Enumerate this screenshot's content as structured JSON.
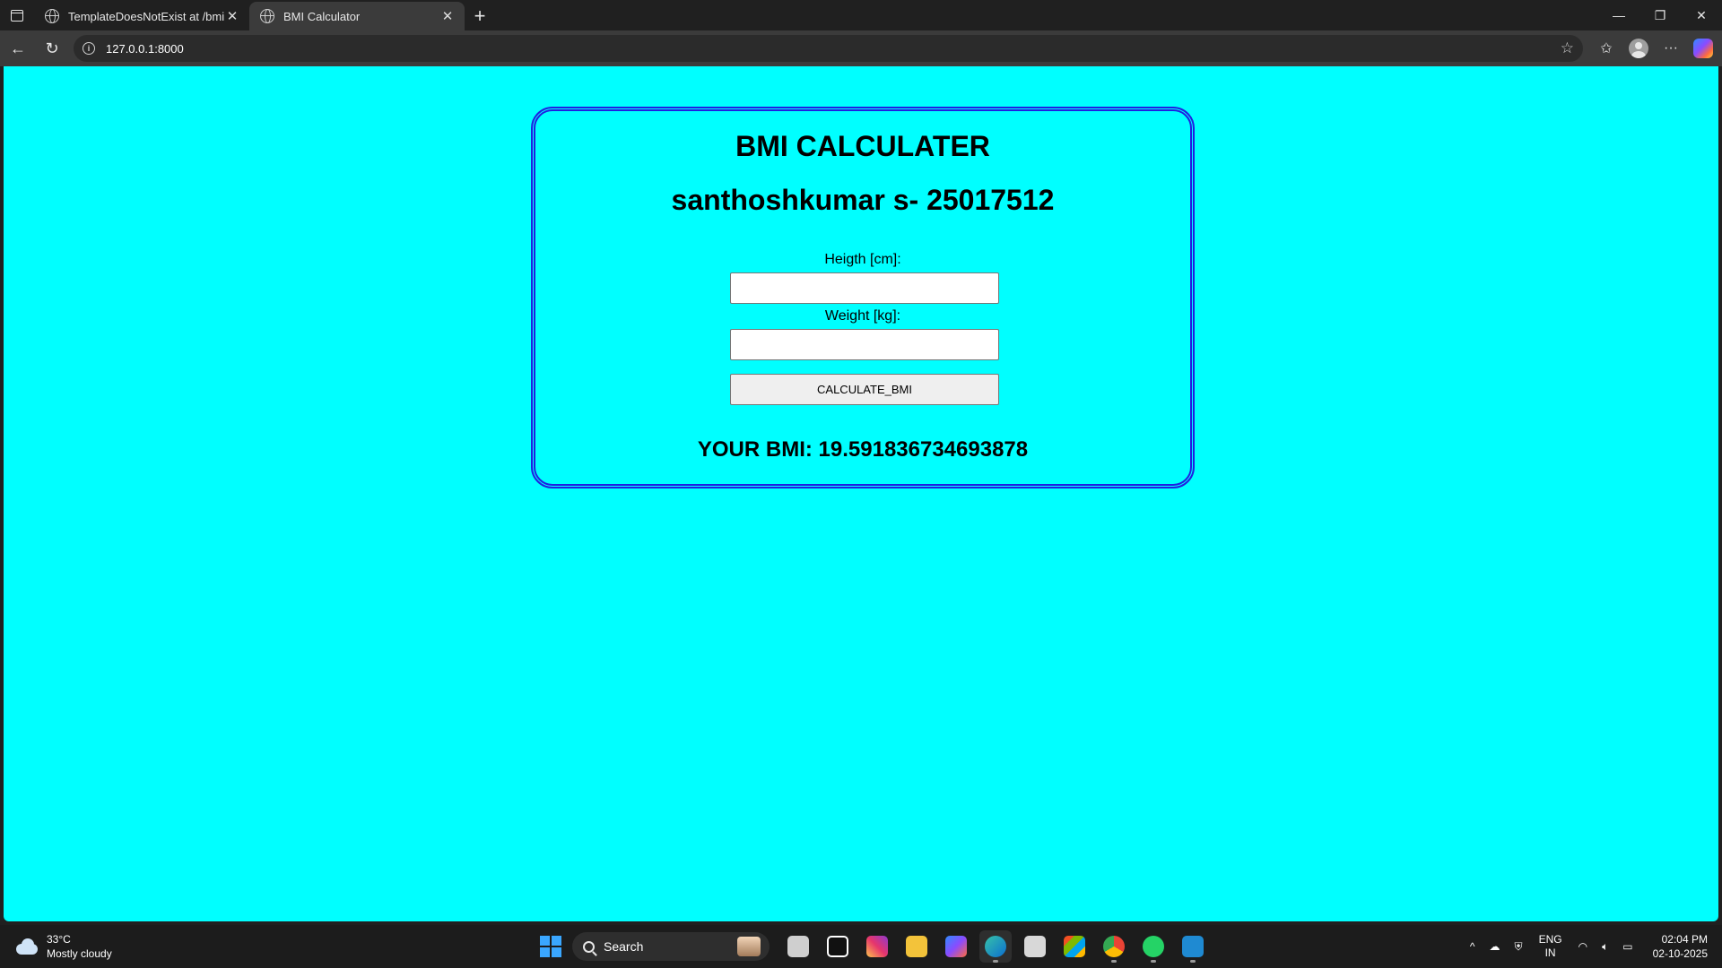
{
  "browser": {
    "tabs": [
      {
        "title": "TemplateDoesNotExist at /bmi/",
        "active": false
      },
      {
        "title": "BMI Calculator",
        "active": true
      }
    ],
    "url": "127.0.0.1:8000"
  },
  "page": {
    "heading": "BMI CALCULATER",
    "subheading": "santhoshkumar s- 25017512",
    "height_label": "Heigth [cm]:",
    "height_value": "",
    "weight_label": "Weight [kg]:",
    "weight_value": "",
    "calculate_label": "CALCULATE_BMI",
    "result": "YOUR BMI: 19.591836734693878",
    "colors": {
      "background": "#00ffff",
      "card_border": "#2020e0"
    }
  },
  "taskbar": {
    "weather_temp": "33°C",
    "weather_desc": "Mostly cloudy",
    "search_placeholder": "Search",
    "lang_line1": "ENG",
    "lang_line2": "IN",
    "time": "02:04 PM",
    "date": "02-10-2025"
  }
}
